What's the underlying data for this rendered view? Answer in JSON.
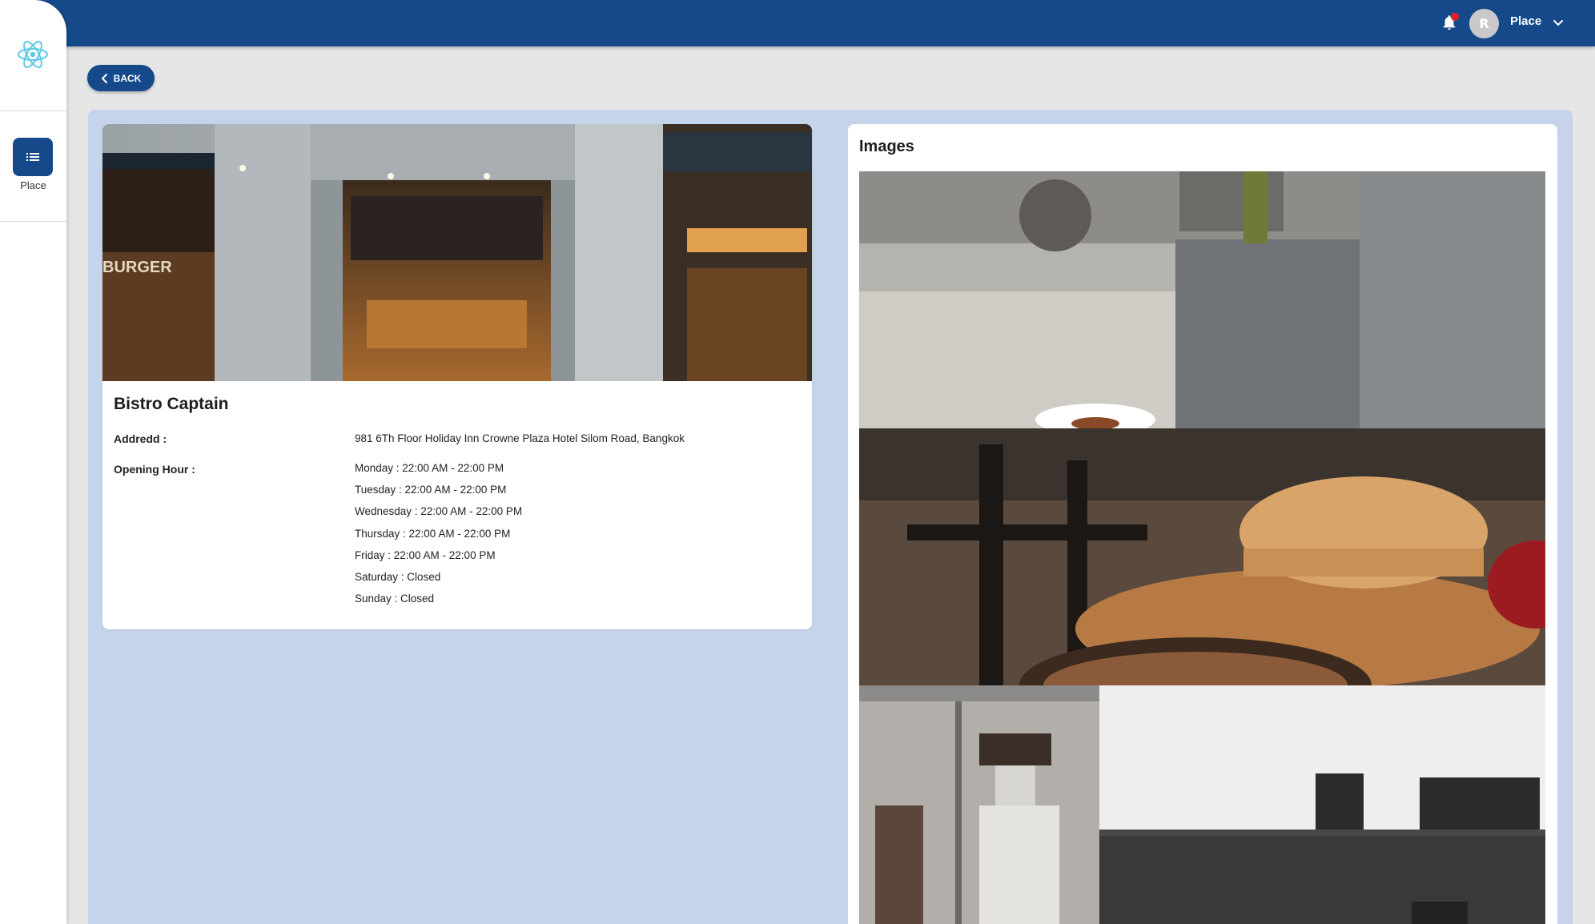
{
  "header": {
    "user_initial": "R",
    "user_name": "Place",
    "brand_color": "#15498a",
    "notification_color": "#e41e2b"
  },
  "sidebar": {
    "items": [
      {
        "label": "Place",
        "icon": "list-icon",
        "active": true
      }
    ]
  },
  "actions": {
    "back_label": "BACK"
  },
  "place": {
    "name": "Bistro Captain",
    "address_label": "Addredd :",
    "address": "981 6Th Floor Holiday Inn Crowne Plaza Hotel Silom Road, Bangkok",
    "hours_label": "Opening Hour :",
    "hours": [
      "Monday : 22:00 AM - 22:00 PM",
      "Tuesday : 22:00 AM - 22:00 PM",
      "Wednesday : 22:00 AM - 22:00 PM",
      "Thursday : 22:00 AM - 22:00 PM",
      "Friday : 22:00 AM - 22:00 PM",
      "Saturday : Closed",
      "Sunday : Closed"
    ]
  },
  "images": {
    "title": "Images"
  }
}
